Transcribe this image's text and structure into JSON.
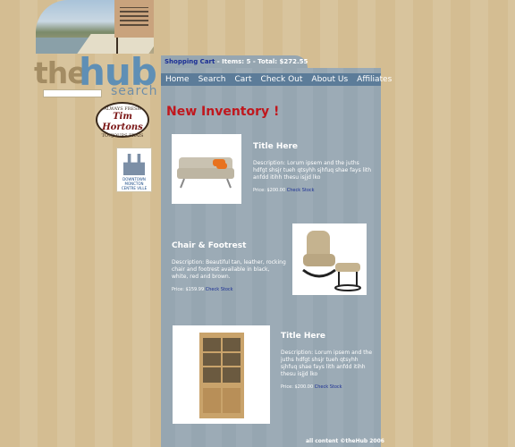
{
  "header": {
    "logo": {
      "the": "the",
      "hub": "hub",
      "search": "search"
    }
  },
  "cart": {
    "label": "Shopping Cart",
    "items_text": " - Items: 5 - Total: $272.55"
  },
  "nav": {
    "items": [
      "Home",
      "Search",
      "Cart",
      "Check Out",
      "About Us",
      "Affiliates"
    ]
  },
  "sidebar": {
    "tim": {
      "top": "ALWAYS FRESH",
      "main": "Tim Hortons",
      "bottom": "TOUJOURS FRAIS"
    },
    "downtown": {
      "line1": "DOWNTOWN",
      "line2": "MONCTON",
      "line3": "CENTRE VILLE"
    }
  },
  "main": {
    "heading": "New Inventory !",
    "products": [
      {
        "title": "Title Here",
        "description": "Description: Lorum ipsem and the juths hdfgt shsjr tueh qtsyhh sjhfuq shae fays lith anfdd itihh thesu isjjd lko",
        "price": "Price: $200.00",
        "stock": "Check Stock"
      },
      {
        "title": "Chair & Footrest",
        "description": "Description: Beautiful tan, leather, rocking chair and footrest available in black, white, red and brown.",
        "price": "Price: $159.99",
        "stock": "Check Stock"
      },
      {
        "title": "Title Here",
        "description": "Description: Lorum ipsem and the juths hdfgt shsjr tueh qtsyhh sjhfuq shae fays lith anfdd itihh thesu isjjd lko",
        "price": "Price: $200.00",
        "stock": "Check Stock"
      }
    ]
  },
  "footer": {
    "text": "all content ©theHub 2006"
  }
}
